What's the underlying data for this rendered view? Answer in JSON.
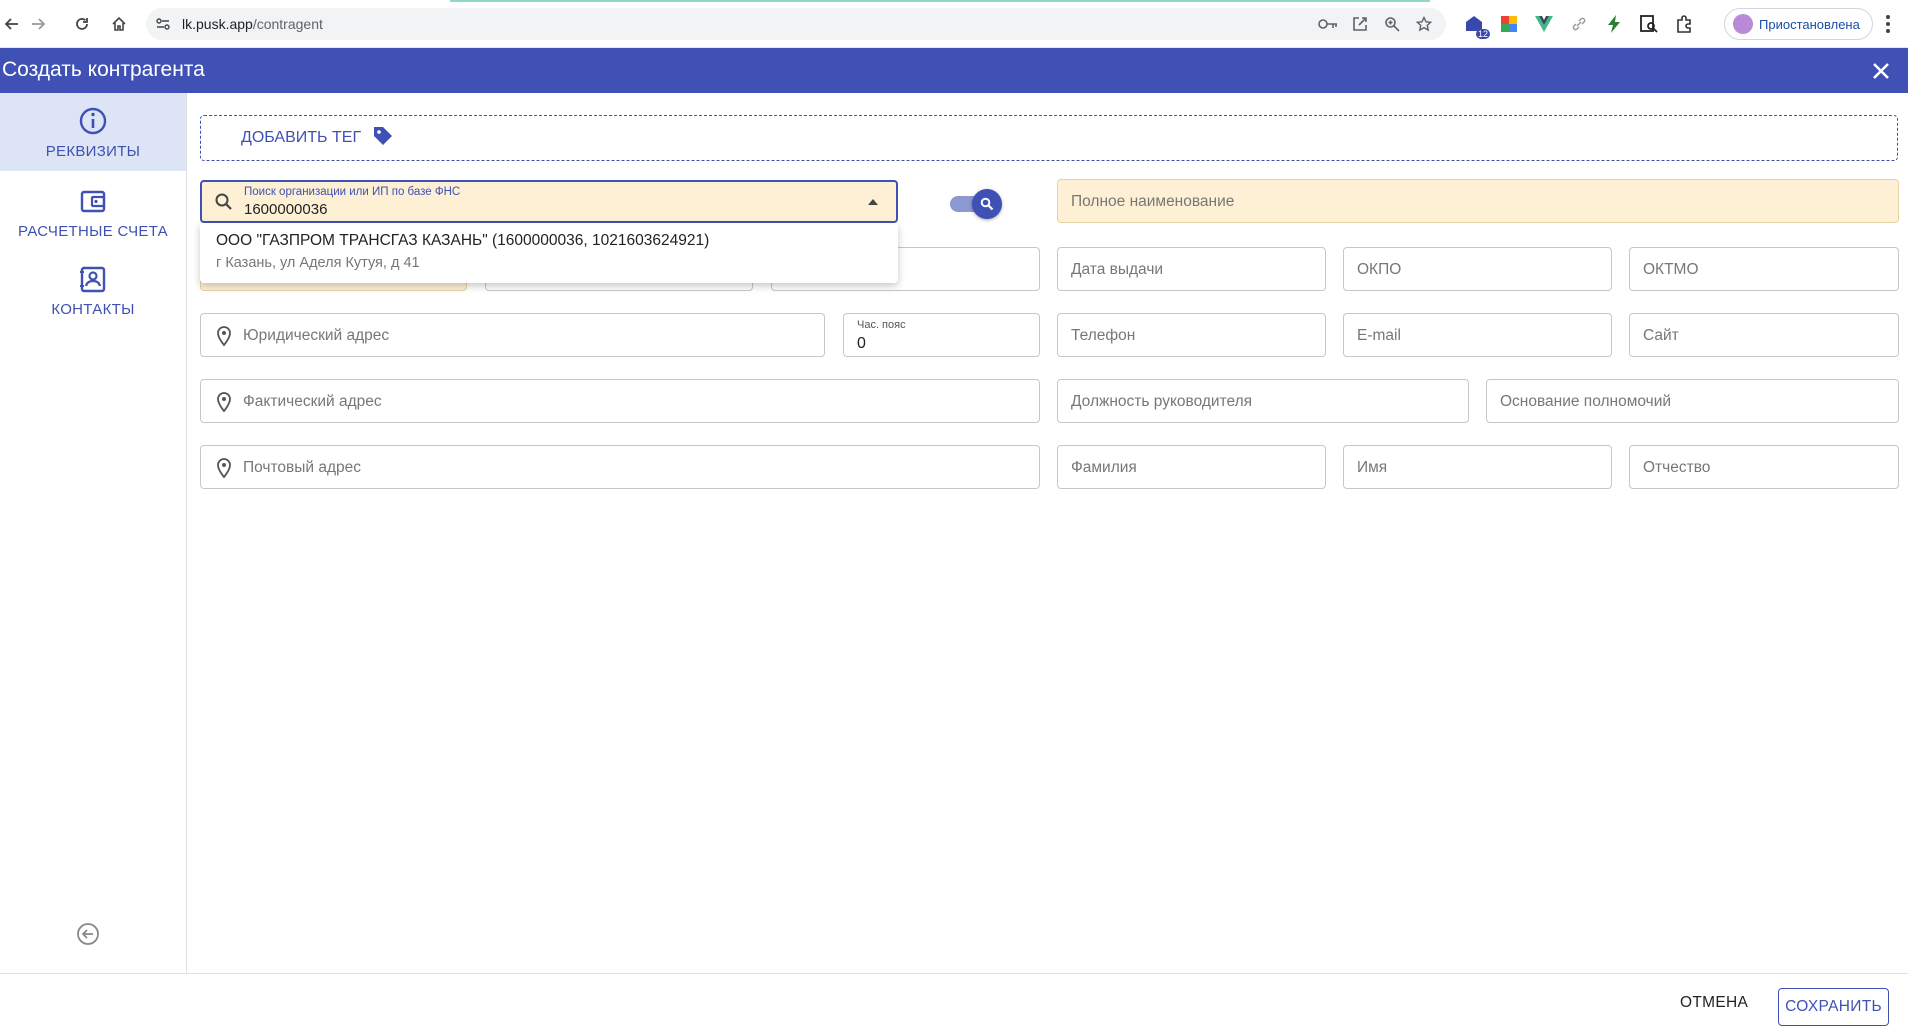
{
  "browser": {
    "url_host": "lk.pusk.app",
    "url_path": "/contragent",
    "extension_badge": "12",
    "profile_label": "Приостановлена"
  },
  "app": {
    "title": "Создать контрагента"
  },
  "sidebar": {
    "items": [
      {
        "label": "РЕКВИЗИТЫ",
        "icon": "info-icon",
        "active": true
      },
      {
        "label": "РАСЧЕТНЫЕ СЧЕТА",
        "icon": "wallet-icon",
        "active": false
      },
      {
        "label": "КОНТАКТЫ",
        "icon": "contact-card-icon",
        "active": false
      }
    ]
  },
  "tag": {
    "label": "ДОБАВИТЬ ТЕГ"
  },
  "search": {
    "label": "Поиск организации или ИП по базе ФНС",
    "value": "1600000036",
    "result_title": "ООО \"ГАЗПРОМ ТРАНСГАЗ КАЗАНЬ\" (1600000036, 1021603624921)",
    "result_address": "г Казань, ул Аделя Кутуя, д 41"
  },
  "form": {
    "full_name": "Полное наименование",
    "issue_date": "Дата выдачи",
    "okpo": "ОКПО",
    "oktmo": "ОКТМО",
    "legal_address": "Юридический адрес",
    "timezone_label": "Час. пояс",
    "timezone_value": "0",
    "phone": "Телефон",
    "email": "E-mail",
    "site": "Сайт",
    "actual_address": "Фактический адрес",
    "head_position": "Должность руководителя",
    "authority_basis": "Основание полномочий",
    "postal_address": "Почтовый адрес",
    "last_name": "Фамилия",
    "first_name": "Имя",
    "patronymic": "Отчество"
  },
  "footer": {
    "cancel": "ОТМЕНА",
    "save": "СОХРАНИТЬ"
  },
  "colors": {
    "primary": "#3f51b5",
    "field_highlight": "#fdf0d5",
    "sidebar_active": "#dde4f5"
  }
}
